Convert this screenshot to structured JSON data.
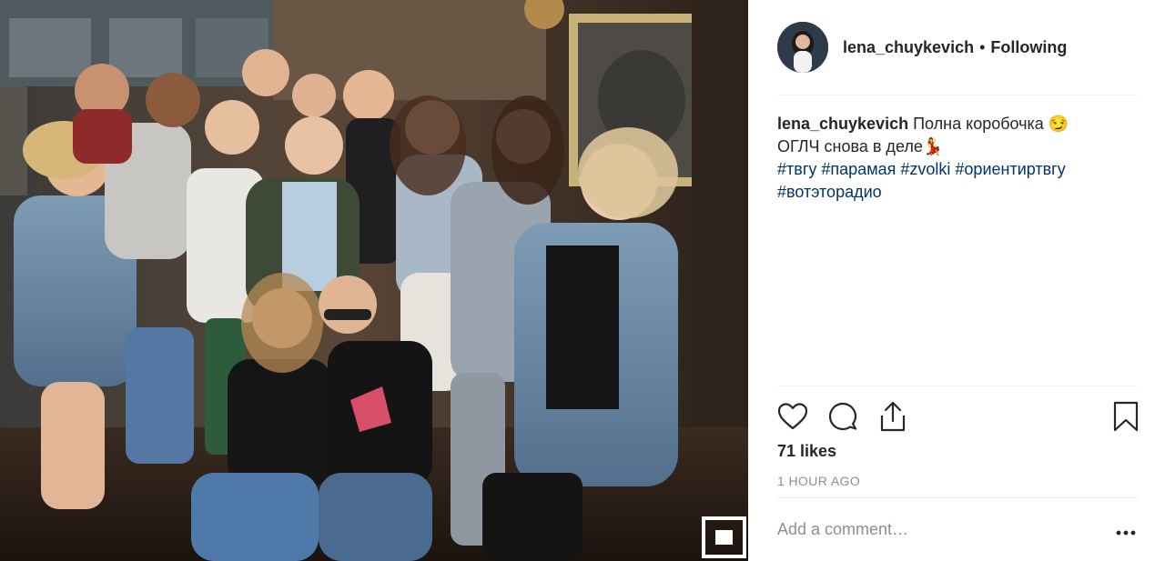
{
  "post": {
    "username": "lena_chuykevich",
    "separator": "•",
    "follow_status": "Following",
    "caption": {
      "username": "lena_chuykevich",
      "line1": "Полна коробочка 😏",
      "line2": "ОГЛЧ снова в деле💃",
      "hashtags": [
        "#твгу",
        "#парамая",
        "#zvolki",
        "#ориентиртвгу",
        "#вотэторадио"
      ]
    },
    "likes": "71 likes",
    "timestamp": "1 HOUR AGO",
    "comment_placeholder": "Add a comment…"
  },
  "icons": {
    "like": "heart-icon",
    "comment": "comment-bubble-icon",
    "share": "share-upload-icon",
    "save": "bookmark-icon",
    "more": "more-options-icon"
  },
  "colors": {
    "text": "#262626",
    "secondary": "#8e8e8e",
    "hashtag": "#003569",
    "divider": "#efefef"
  }
}
